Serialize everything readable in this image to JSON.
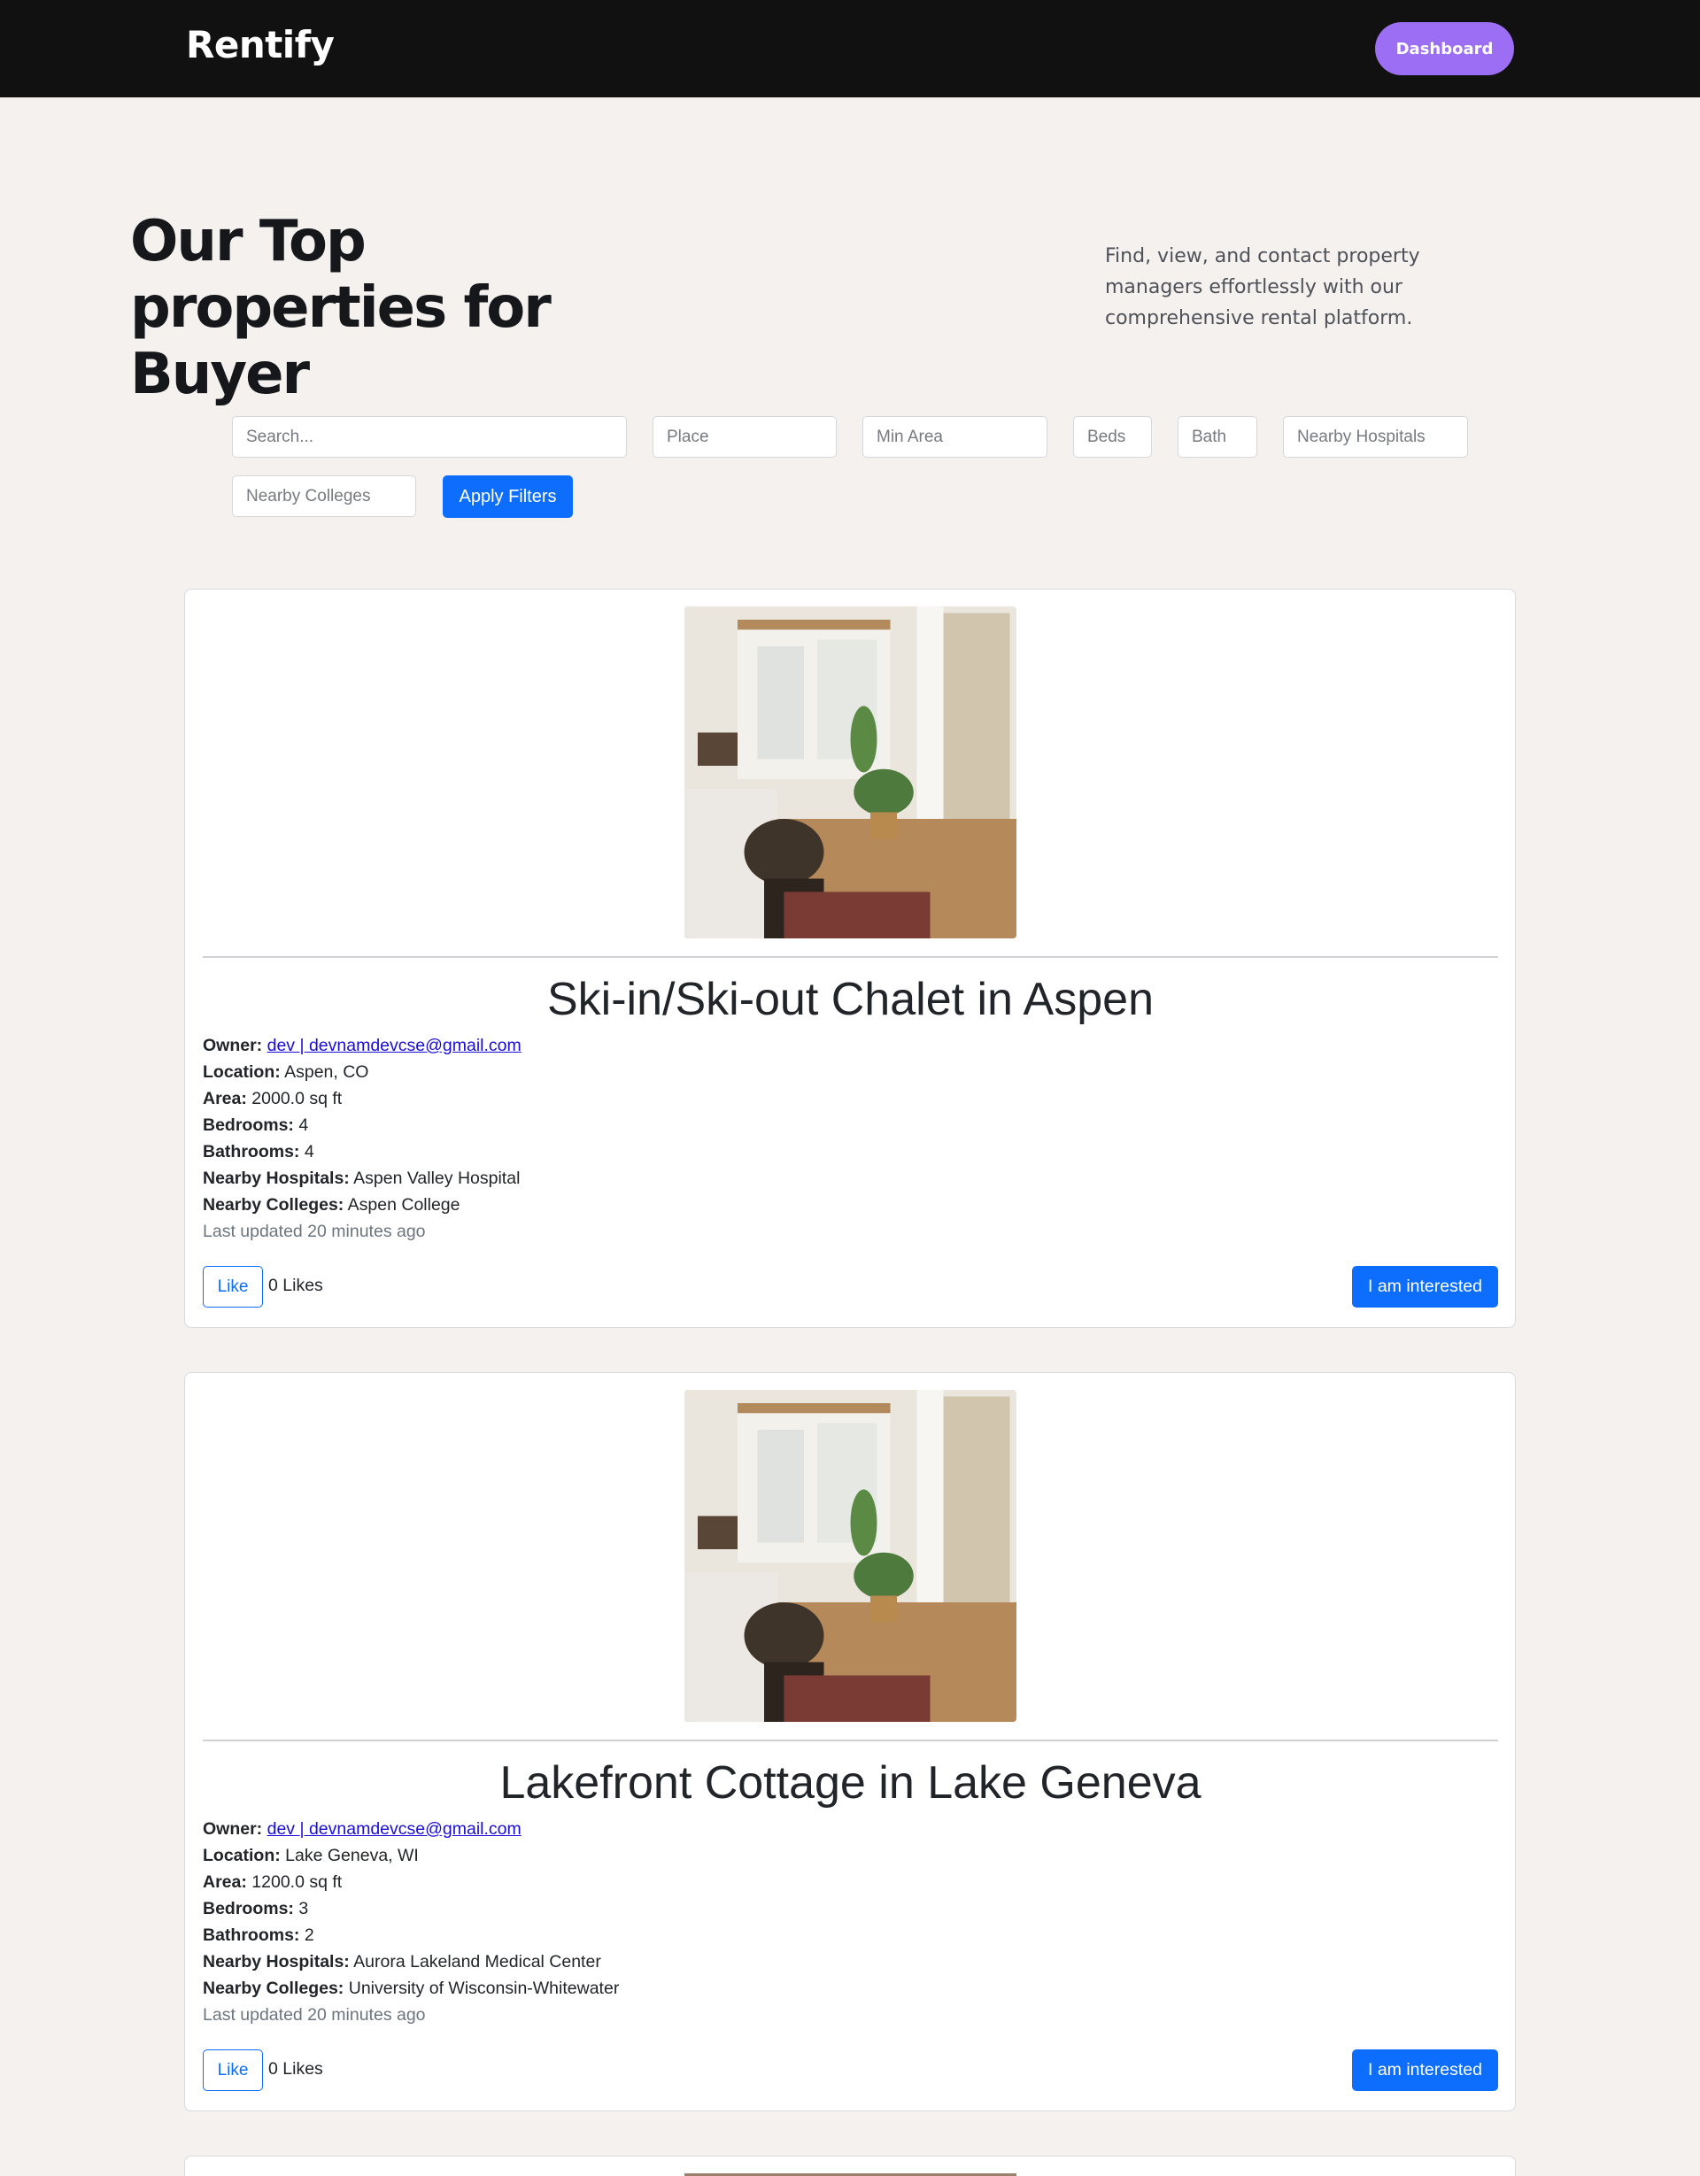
{
  "navbar": {
    "brand": "Rentify",
    "dashboard_label": "Dashboard"
  },
  "hero": {
    "title": "Our Top properties for Buyer",
    "description": "Find, view, and contact property managers effortlessly with our comprehensive rental platform."
  },
  "filters": {
    "search_placeholder": "Search...",
    "place_placeholder": "Place",
    "min_area_placeholder": "Min Area",
    "beds_placeholder": "Beds",
    "baths_placeholder": "Bath",
    "hospitals_placeholder": "Nearby Hospitals",
    "colleges_placeholder": "Nearby Colleges",
    "apply_label": "Apply Filters"
  },
  "labels": {
    "owner": "Owner:",
    "location": "Location:",
    "area": "Area:",
    "bedrooms": "Bedrooms:",
    "bathrooms": "Bathrooms:",
    "hospitals": "Nearby Hospitals:",
    "colleges": "Nearby Colleges:",
    "like": "Like",
    "interested": "I am interested"
  },
  "properties": [
    {
      "title": "Ski-in/Ski-out Chalet in Aspen",
      "owner": "dev | devnamdevcse@gmail.com",
      "location": "Aspen, CO",
      "area": "2000.0 sq ft",
      "bedrooms": "4",
      "bathrooms": "4",
      "hospitals": "Aspen Valley Hospital",
      "colleges": "Aspen College",
      "updated": "Last updated 20 minutes ago",
      "likes": "0 Likes"
    },
    {
      "title": "Lakefront Cottage in Lake Geneva",
      "owner": "dev | devnamdevcse@gmail.com",
      "location": "Lake Geneva, WI",
      "area": "1200.0 sq ft",
      "bedrooms": "3",
      "bathrooms": "2",
      "hospitals": "Aurora Lakeland Medical Center",
      "colleges": "University of Wisconsin-Whitewater",
      "updated": "Last updated 20 minutes ago",
      "likes": "0 Likes"
    }
  ]
}
